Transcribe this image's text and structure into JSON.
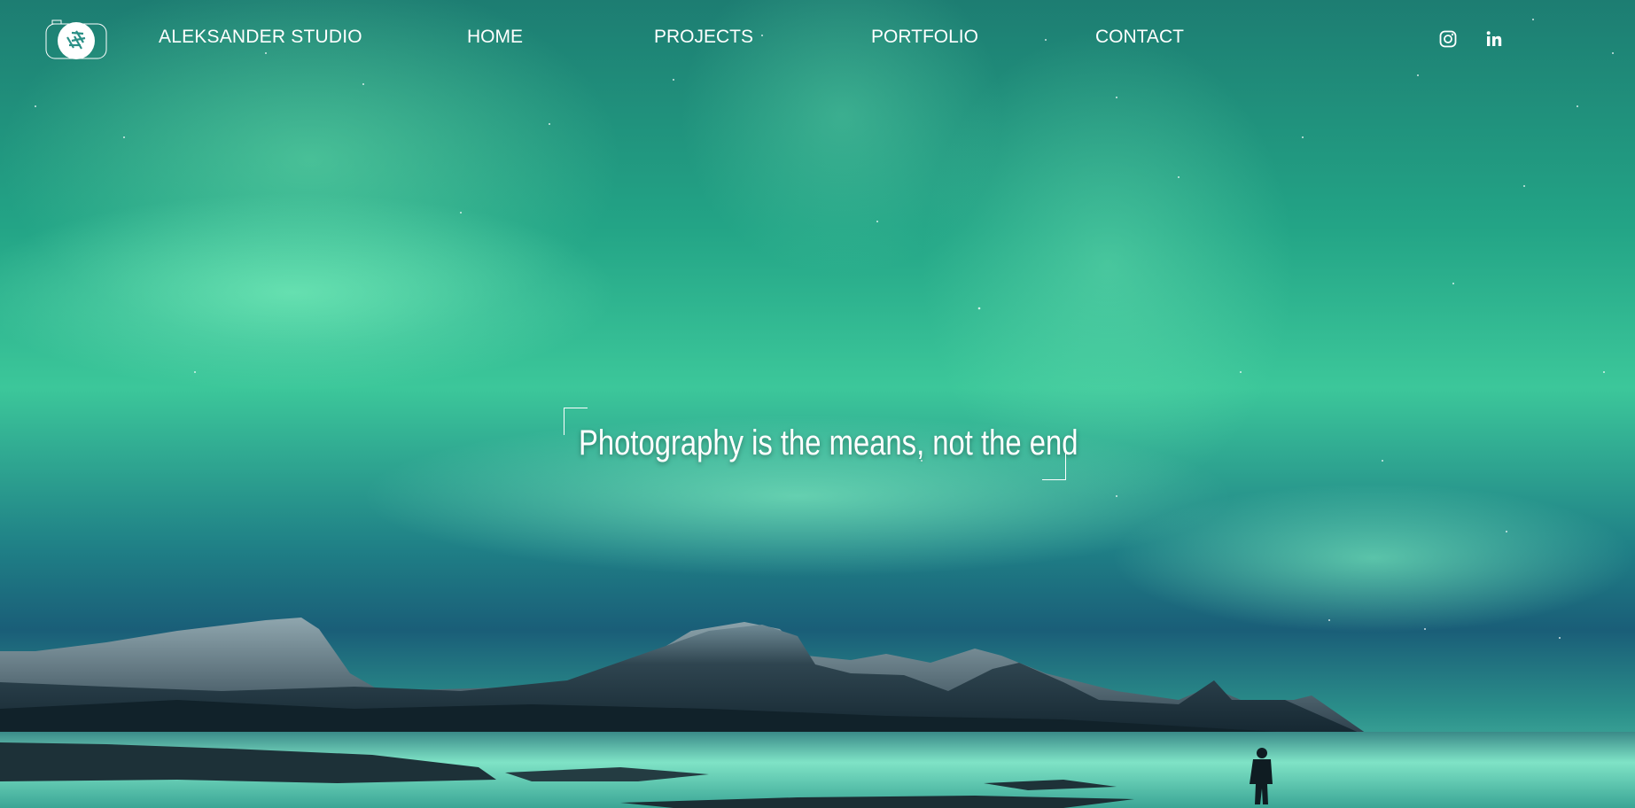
{
  "site": {
    "brand": "ALEKSANDER STUDIO",
    "logo_icon": "camera-aperture-icon"
  },
  "nav": {
    "links": [
      {
        "label": "HOME"
      },
      {
        "label": "PROJECTS"
      },
      {
        "label": "PORTFOLIO"
      },
      {
        "label": "CONTACT"
      }
    ]
  },
  "social": [
    {
      "icon": "instagram-icon"
    },
    {
      "icon": "linkedin-icon"
    }
  ],
  "hero": {
    "tagline": "Photography is the means, not the end",
    "background": "aurora-borealis-over-mountains-and-beach"
  },
  "colors": {
    "text": "#ffffff",
    "aurora": "#3cc79a",
    "sky": "#1d7d72"
  }
}
